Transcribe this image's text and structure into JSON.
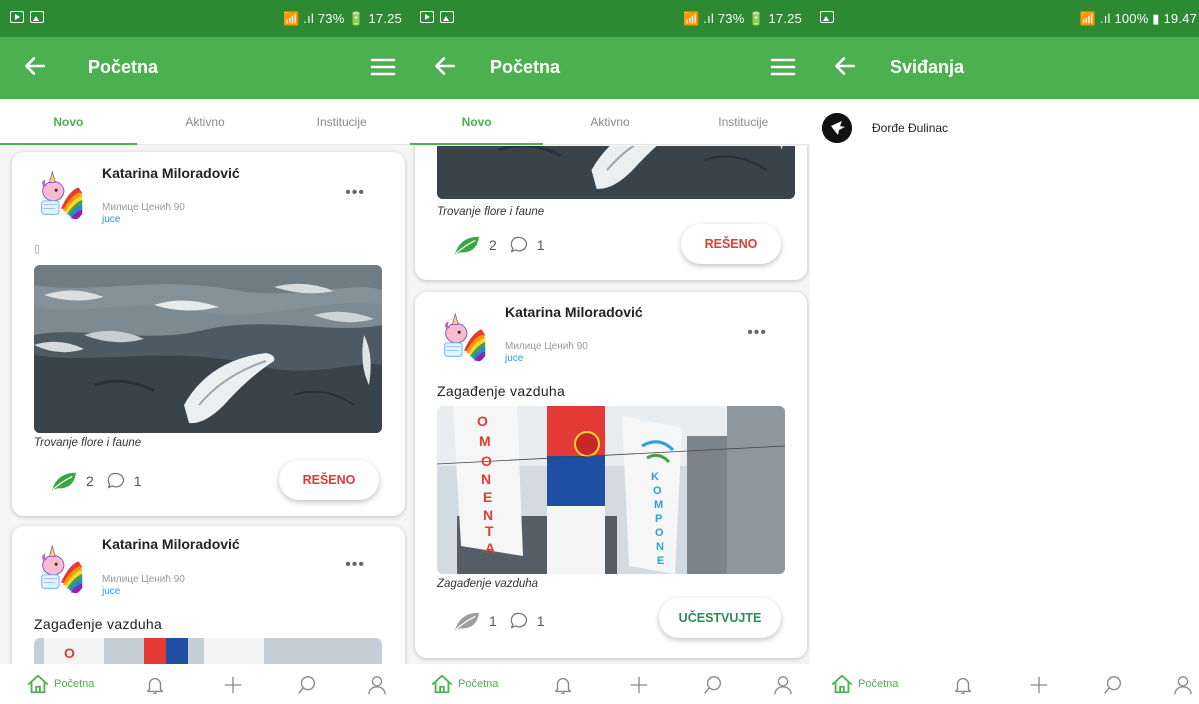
{
  "status": {
    "p1": "📶 .ıl 73% 🔋 17.25",
    "p2": "📶 .ıl 73% 🔋 17.25",
    "p3": "📶 .ıl 100% ▮ 19.47"
  },
  "appbar": {
    "home_title": "Početna",
    "likes_title": "Sviđanja"
  },
  "tabs": [
    "Novo",
    "Aktivno",
    "Institucije"
  ],
  "posts": [
    {
      "author": "Katarina Miloradović",
      "address": "Милице Ценић 90",
      "time": "juce",
      "glyph": "▯",
      "caption": "Trovanje flore i faune",
      "likes": "2",
      "comments": "1",
      "action": "REŠENO",
      "liked": true
    },
    {
      "author": "Katarina Miloradović",
      "address": "Милице Ценић 90",
      "time": "juce",
      "title": "Zagađenje vazduha",
      "caption": "Zagađenje vazduha",
      "likes": "1",
      "comments": "1",
      "action": "UČESTVUJTE",
      "liked": false
    }
  ],
  "flag_letters": {
    "left": "KOMPONENTA",
    "right": "KOMPONENTA"
  },
  "nav": {
    "home_label": "Početna"
  },
  "likes_list": [
    {
      "name": "Đorđe Đulinac"
    }
  ],
  "colors": {
    "status_bar": "#2b8a32",
    "app_bar": "#4caf50",
    "accent": "#4caf50",
    "resolved": "#e53935",
    "participate": "#2e8b57",
    "time": "#2196f3"
  },
  "icons": {
    "back": "arrow-left-icon",
    "menu": "hamburger-menu-icon",
    "like": "leaf-icon",
    "comment": "comment-bubble-icon",
    "more": "more-dots-icon",
    "home": "home-icon",
    "notifications": "bell-icon",
    "add": "plus-icon",
    "search": "search-icon",
    "profile": "user-icon"
  }
}
